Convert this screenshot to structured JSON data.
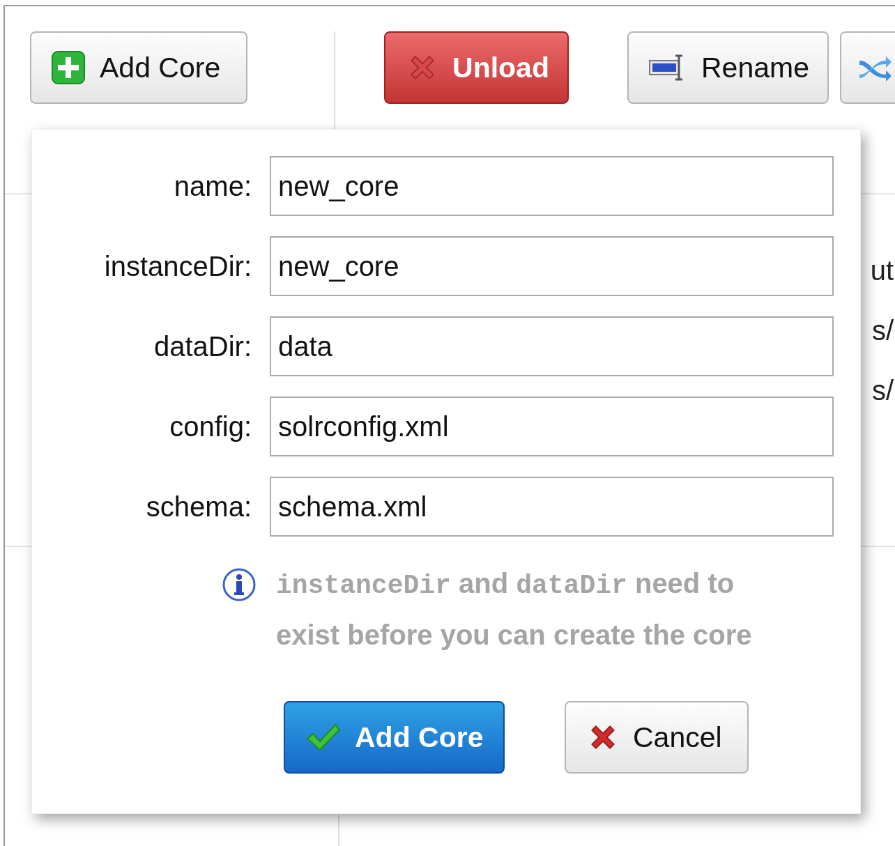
{
  "toolbar": {
    "buttons": [
      {
        "kind": "add",
        "label": "Add Core"
      },
      {
        "kind": "unload",
        "label": "Unload"
      },
      {
        "kind": "rename",
        "label": "Rename"
      },
      {
        "kind": "swap"
      }
    ]
  },
  "background_text": [
    "ut",
    "s/",
    "s/"
  ],
  "dialog": {
    "fields": [
      {
        "label": "name:",
        "value": "new_core"
      },
      {
        "label": "instanceDir:",
        "value": "new_core"
      },
      {
        "label": "dataDir:",
        "value": "data"
      },
      {
        "label": "config:",
        "value": "solrconfig.xml"
      },
      {
        "label": "schema:",
        "value": "schema.xml"
      }
    ],
    "note": [
      {
        "kind": "code",
        "text": "instanceDir"
      },
      {
        "kind": "plain",
        "text": " and "
      },
      {
        "kind": "code",
        "text": "dataDir"
      },
      {
        "kind": "plain",
        "text": " need to exist before you can create the core"
      }
    ],
    "actions": [
      {
        "kind": "primary",
        "label": "Add Core"
      },
      {
        "kind": "cancel",
        "label": "Cancel"
      }
    ]
  }
}
